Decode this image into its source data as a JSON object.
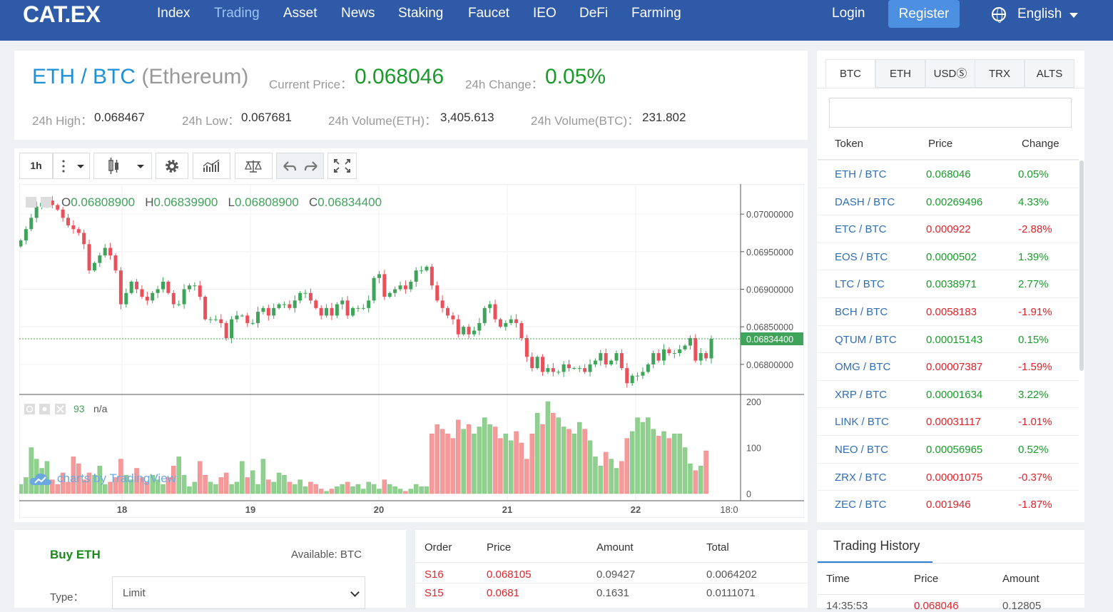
{
  "nav": {
    "logo": "CAT.EX",
    "items": [
      "Index",
      "Trading",
      "Asset",
      "News",
      "Staking",
      "Faucet",
      "IEO",
      "DeFi",
      "Farming"
    ],
    "active": "Trading",
    "login": "Login",
    "register": "Register",
    "language": "English"
  },
  "ticker": {
    "pair": "ETH / BTC",
    "name": "(Ethereum)",
    "current_price_label": "Current Price：",
    "current_price": "0.068046",
    "change_label": "24h Change：",
    "change": "0.05%",
    "high_label": "24h High：",
    "high": "0.068467",
    "low_label": "24h Low：",
    "low": "0.067681",
    "vol_eth_label": "24h Volume(ETH)：",
    "vol_eth": "3,405.613",
    "vol_btc_label": "24h Volume(BTC)：",
    "vol_btc": "231.802"
  },
  "chart_toolbar": {
    "interval": "1h"
  },
  "chart_data": {
    "type": "candlestick",
    "ohlc_legend": {
      "o_label": "O",
      "o": "0.06808900",
      "h_label": "H",
      "h": "0.06839900",
      "l_label": "L",
      "l": "0.06808900",
      "c_label": "C",
      "c": "0.06834400"
    },
    "price_ticks": [
      "0.07000000",
      "0.06950000",
      "0.06900000",
      "0.06850000",
      "0.06800000"
    ],
    "last_price_tag": "0.06834400",
    "volume_ticks": [
      "200",
      "100",
      "0"
    ],
    "volume_indicator": {
      "value": "93",
      "na": "n/a"
    },
    "x_ticks": [
      "18",
      "19",
      "20",
      "21",
      "22",
      "18:0"
    ],
    "ylim": [
      0.0676,
      0.0704
    ],
    "closes": [
      0.06965,
      0.0698,
      0.06995,
      0.0701,
      0.07015,
      0.07018,
      0.07012,
      0.07006,
      0.06995,
      0.06985,
      0.0698,
      0.06975,
      0.0696,
      0.06925,
      0.06935,
      0.06945,
      0.06955,
      0.06945,
      0.06925,
      0.0688,
      0.06895,
      0.0691,
      0.069,
      0.0689,
      0.06885,
      0.06895,
      0.069,
      0.0691,
      0.06895,
      0.0688,
      0.0688,
      0.069,
      0.06905,
      0.06905,
      0.0689,
      0.0686,
      0.0686,
      0.0686,
      0.06855,
      0.06835,
      0.0686,
      0.06865,
      0.06865,
      0.06855,
      0.06855,
      0.0687,
      0.06875,
      0.06865,
      0.06875,
      0.0688,
      0.0688,
      0.06875,
      0.06885,
      0.06895,
      0.06895,
      0.06885,
      0.06875,
      0.06865,
      0.06875,
      0.06865,
      0.0688,
      0.06885,
      0.06865,
      0.06875,
      0.06875,
      0.06875,
      0.06885,
      0.06915,
      0.0692,
      0.0689,
      0.06895,
      0.069,
      0.06905,
      0.069,
      0.0691,
      0.06925,
      0.06925,
      0.0693,
      0.06905,
      0.06885,
      0.06875,
      0.06865,
      0.0686,
      0.0684,
      0.0685,
      0.0684,
      0.06845,
      0.06855,
      0.06875,
      0.0688,
      0.0686,
      0.0685,
      0.06855,
      0.0686,
      0.06855,
      0.06835,
      0.0681,
      0.06795,
      0.0681,
      0.0679,
      0.06795,
      0.0679,
      0.0679,
      0.068,
      0.06795,
      0.06795,
      0.06795,
      0.0679,
      0.068,
      0.06805,
      0.06815,
      0.068,
      0.06805,
      0.06815,
      0.06795,
      0.06775,
      0.06785,
      0.06785,
      0.0679,
      0.068,
      0.06815,
      0.06805,
      0.0682,
      0.06815,
      0.06815,
      0.0682,
      0.06825,
      0.06835,
      0.06805,
      0.06815,
      0.06808,
      0.06834
    ],
    "volumes": [
      20,
      35,
      100,
      75,
      55,
      70,
      30,
      20,
      45,
      25,
      80,
      65,
      30,
      45,
      40,
      60,
      20,
      25,
      35,
      75,
      40,
      30,
      55,
      35,
      25,
      40,
      30,
      20,
      35,
      60,
      80,
      40,
      15,
      25,
      70,
      40,
      25,
      20,
      35,
      45,
      20,
      25,
      70,
      35,
      50,
      20,
      75,
      30,
      25,
      45,
      40,
      25,
      20,
      30,
      15,
      25,
      20,
      10,
      5,
      10,
      15,
      20,
      25,
      15,
      20,
      10,
      25,
      20,
      10,
      30,
      20,
      15,
      10,
      5,
      10,
      20,
      15,
      15,
      130,
      150,
      140,
      130,
      120,
      160,
      140,
      150,
      130,
      145,
      165,
      150,
      145,
      120,
      130,
      115,
      135,
      110,
      75,
      130,
      175,
      150,
      200,
      175,
      165,
      145,
      140,
      130,
      155,
      140,
      115,
      80,
      60,
      90,
      75,
      55,
      70,
      120,
      135,
      165,
      155,
      165,
      140,
      125,
      135,
      120,
      130,
      130,
      100,
      65,
      50,
      60,
      93
    ]
  },
  "tv_credit": "charts by TradingView",
  "market": {
    "tabs": [
      "BTC",
      "ETH",
      "USDⓈ",
      "TRX",
      "ALTS"
    ],
    "active_tab": "BTC",
    "headers": {
      "token": "Token",
      "price": "Price",
      "change": "Change"
    },
    "rows": [
      {
        "pair": "ETH / BTC",
        "price": "0.068046",
        "change": "0.05%",
        "dir": "up"
      },
      {
        "pair": "DASH / BTC",
        "price": "0.00269496",
        "change": "4.33%",
        "dir": "up"
      },
      {
        "pair": "ETC / BTC",
        "price": "0.000922",
        "change": "-2.88%",
        "dir": "down"
      },
      {
        "pair": "EOS / BTC",
        "price": "0.0000502",
        "change": "1.39%",
        "dir": "up"
      },
      {
        "pair": "LTC / BTC",
        "price": "0.0038971",
        "change": "2.77%",
        "dir": "up"
      },
      {
        "pair": "BCH / BTC",
        "price": "0.0058183",
        "change": "-1.91%",
        "dir": "down"
      },
      {
        "pair": "QTUM / BTC",
        "price": "0.00015143",
        "change": "0.15%",
        "dir": "up"
      },
      {
        "pair": "OMG / BTC",
        "price": "0.00007387",
        "change": "-1.59%",
        "dir": "down"
      },
      {
        "pair": "XRP / BTC",
        "price": "0.00001634",
        "change": "3.22%",
        "dir": "up"
      },
      {
        "pair": "LINK / BTC",
        "price": "0.00031117",
        "change": "-1.01%",
        "dir": "down"
      },
      {
        "pair": "NEO / BTC",
        "price": "0.00056965",
        "change": "0.52%",
        "dir": "up"
      },
      {
        "pair": "ZRX / BTC",
        "price": "0.00001075",
        "change": "-0.37%",
        "dir": "down"
      },
      {
        "pair": "ZEC / BTC",
        "price": "0.001946",
        "change": "-1.87%",
        "dir": "down"
      }
    ]
  },
  "buy": {
    "title": "Buy ETH",
    "available": "Available: BTC",
    "type_label": "Type：",
    "type_value": "Limit"
  },
  "orders": {
    "headers": {
      "order": "Order",
      "price": "Price",
      "amount": "Amount",
      "total": "Total"
    },
    "rows": [
      {
        "order": "S16",
        "price": "0.068105",
        "amount": "0.09427",
        "total": "0.0064202"
      },
      {
        "order": "S15",
        "price": "0.0681",
        "amount": "0.1631",
        "total": "0.0111071"
      }
    ]
  },
  "history": {
    "title": "Trading History",
    "headers": {
      "time": "Time",
      "price": "Price",
      "amount": "Amount"
    },
    "rows": [
      {
        "time": "14:35:53",
        "price": "0.068046",
        "amount": "0.12805"
      }
    ]
  },
  "colors": {
    "nav_bg": "#2f5aa8",
    "up": "#1a9a2a",
    "down": "#e0242c",
    "candle_up": "#3fa35a",
    "candle_down": "#e8505b",
    "vol_up": "#8fd08f",
    "vol_down": "#f59a9a"
  }
}
